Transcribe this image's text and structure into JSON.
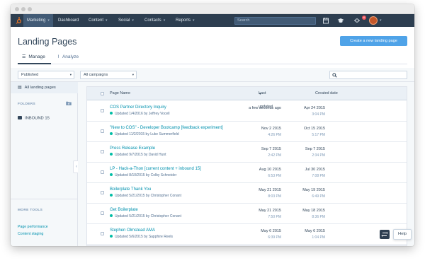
{
  "nav": {
    "items": [
      {
        "label": "Marketing",
        "dropdown": true
      },
      {
        "label": "Dashboard",
        "dropdown": false
      },
      {
        "label": "Content",
        "dropdown": true
      },
      {
        "label": "Social",
        "dropdown": true
      },
      {
        "label": "Contacts",
        "dropdown": true
      },
      {
        "label": "Reports",
        "dropdown": true
      }
    ],
    "search_placeholder": "Search",
    "notification_count": "6",
    "icons": [
      "sprocket-logo",
      "calendar-icon",
      "graduation-cap-icon",
      "sprocket-notifications-icon",
      "avatar"
    ]
  },
  "header": {
    "title": "Landing Pages",
    "create_button": "Create a new landing page",
    "tabs": [
      {
        "label": "Manage",
        "icon": "list-icon",
        "active": true
      },
      {
        "label": "Analyze",
        "icon": "pulse-icon",
        "active": false
      }
    ]
  },
  "filters": {
    "status": "Published",
    "campaign": "All campaigns",
    "search_placeholder": ""
  },
  "sidebar": {
    "all_label": "All landing pages",
    "folders_heading": "FOLDERS",
    "folders": [
      {
        "label": "INBOUND 15"
      }
    ],
    "more_tools_heading": "MORE TOOLS",
    "tools": [
      {
        "label": "Page performance"
      },
      {
        "label": "Content staging"
      }
    ]
  },
  "table": {
    "columns": {
      "name": "Page Name",
      "updated": "Last updated",
      "created": "Created date"
    },
    "sort": "Last updated descending",
    "rows": [
      {
        "name": "COS Partner Directory Inquiry",
        "meta": "Updated 1/4/2016 by Jeffrey Vocell",
        "updated_date": "a few seconds ago",
        "updated_time": "",
        "created_date": "Apr 24 2015",
        "created_time": "3:04 PM"
      },
      {
        "name": "\"New to COS\" - Developer Bootcamp [feedback experiment]",
        "meta": "Updated 11/2/2015 by Luke Summerfield",
        "updated_date": "Nov 2 2015",
        "updated_time": "4:26 PM",
        "created_date": "Oct 15 2015",
        "created_time": "5:17 PM"
      },
      {
        "name": "Press Release Example",
        "meta": "Updated 9/7/2015 by David Hunt",
        "updated_date": "Sep 7 2015",
        "updated_time": "2:42 PM",
        "created_date": "Sep 7 2015",
        "created_time": "2:34 PM"
      },
      {
        "name": "LP - Hack-a-Thon [current content + inbound 15]",
        "meta": "Updated 8/10/2015 by Colby Schneider",
        "updated_date": "Aug 10 2015",
        "updated_time": "6:53 PM",
        "created_date": "Jul 30 2015",
        "created_time": "7:08 PM"
      },
      {
        "name": "Boilerplate Thank You",
        "meta": "Updated 5/21/2015 by Christopher Conant",
        "updated_date": "May 21 2015",
        "updated_time": "8:03 PM",
        "created_date": "May 19 2015",
        "created_time": "6:49 PM"
      },
      {
        "name": "Get Boilerplate",
        "meta": "Updated 5/21/2015 by Christopher Conant",
        "updated_date": "May 21 2015",
        "updated_time": "7:50 PM",
        "created_date": "May 18 2015",
        "created_time": "8:36 PM"
      },
      {
        "name": "Stephen Olmstead AMA",
        "meta": "Updated 5/6/2015 by Sapphire Reels",
        "updated_date": "May 6 2015",
        "updated_time": "6:39 PM",
        "created_date": "May 6 2015",
        "created_time": "1:04 PM"
      }
    ]
  },
  "help": {
    "label": "Help"
  },
  "colors": {
    "nav_bg": "#2d3e50",
    "accent": "#4fa3e8",
    "link": "#0091ae",
    "status_green": "#00bda5"
  }
}
